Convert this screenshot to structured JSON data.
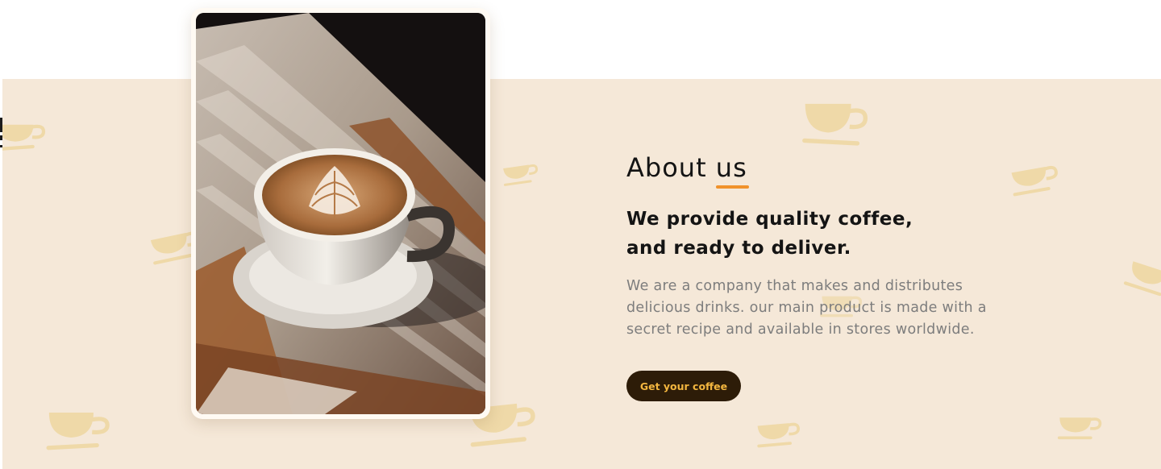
{
  "about": {
    "title_prefix": "About ",
    "title_accent": "us",
    "headline_line1": "We provide quality coffee,",
    "headline_line2": "and ready to deliver.",
    "body_line1": "We are a company that makes and distributes",
    "body_line2": "delicious drinks. our main product is made with a",
    "body_line3": "secret recipe and available in stores worldwide.",
    "cta_label": "Get your coffee"
  },
  "media": {
    "photo_description": "latte-art-cup-photo"
  },
  "colors": {
    "band_background": "#f5e8d8",
    "pattern_cup": "#efd9a8",
    "accent_underline": "#f0922b",
    "button_background": "#2d1c08",
    "button_text": "#f3b63f",
    "heading_text": "#141414",
    "body_text": "#7d7d7d"
  },
  "icons": {
    "background_pattern": "coffee-cup-icon"
  }
}
